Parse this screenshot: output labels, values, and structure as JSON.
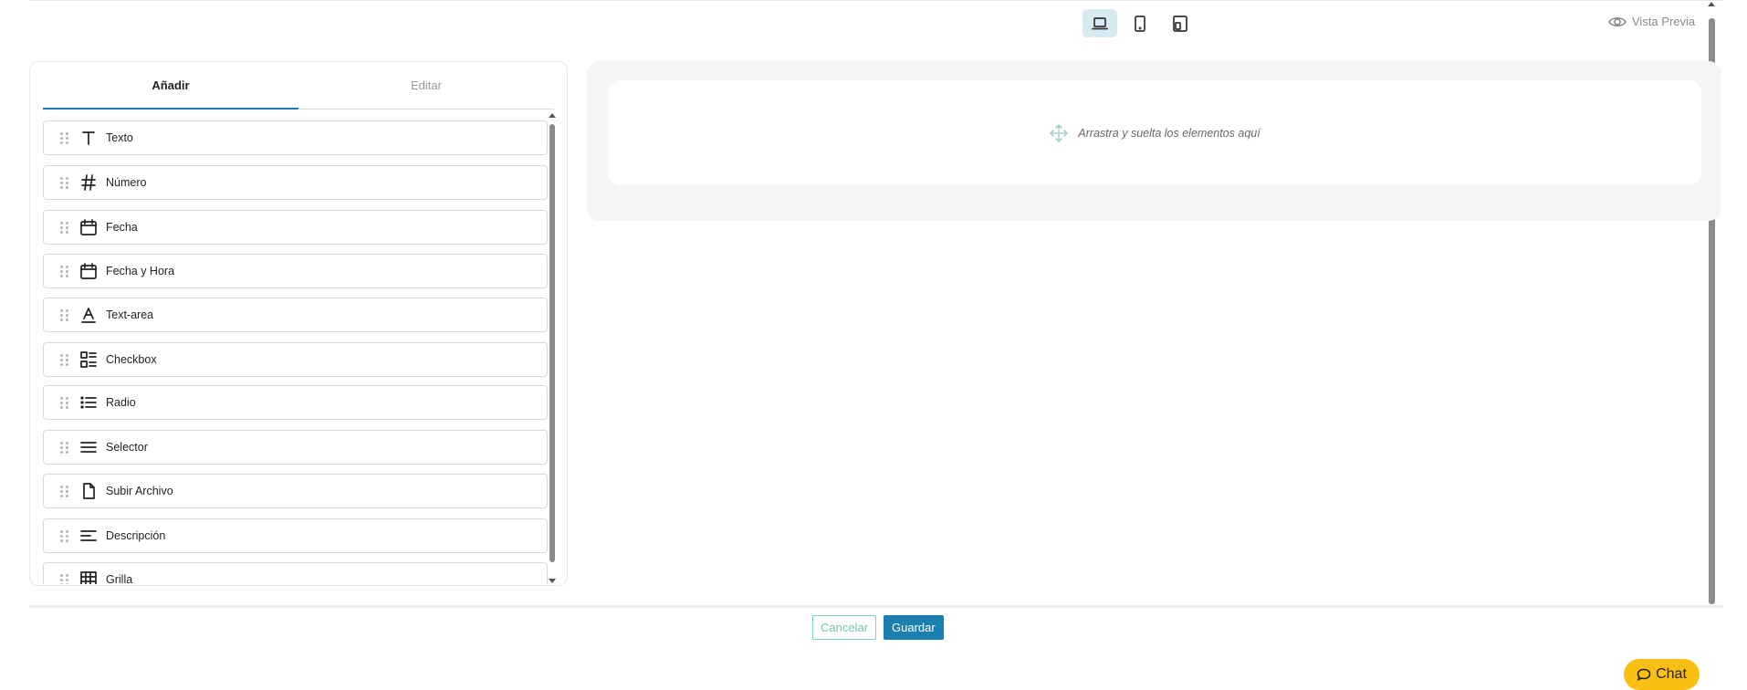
{
  "toolbar": {
    "devices": [
      {
        "name": "laptop-icon",
        "active": true
      },
      {
        "name": "tablet-icon",
        "active": false
      },
      {
        "name": "responsive-icon",
        "active": false
      }
    ],
    "preview_label": "Vista Previa"
  },
  "panel": {
    "tabs": [
      {
        "label": "Añadir",
        "active": true
      },
      {
        "label": "Editar",
        "active": false
      }
    ],
    "items": [
      {
        "label": "Texto",
        "icon": "text-icon"
      },
      {
        "label": "Número",
        "icon": "hash-icon"
      },
      {
        "label": "Fecha",
        "icon": "calendar-icon"
      },
      {
        "label": "Fecha y Hora",
        "icon": "calendar-icon"
      },
      {
        "label": "Text-area",
        "icon": "text-area-icon"
      },
      {
        "label": "Checkbox",
        "icon": "checkbox-list-icon"
      },
      {
        "label": "Radio",
        "icon": "bullet-list-icon"
      },
      {
        "label": "Selector",
        "icon": "menu-lines-icon"
      },
      {
        "label": "Subir Archivo",
        "icon": "file-icon"
      },
      {
        "label": "Descripción",
        "icon": "align-left-icon"
      },
      {
        "label": "Grilla",
        "icon": "grid-icon"
      }
    ]
  },
  "canvas": {
    "placeholder": "Arrastra y suelta los elementos aquí",
    "icon": "move-icon"
  },
  "actions": {
    "cancel_label": "Cancelar",
    "save_label": "Guardar"
  },
  "chat": {
    "label": "Chat",
    "icon": "chat-bubble-icon"
  },
  "colors": {
    "accent": "#1b7fb0",
    "cancel": "#6fc5b6",
    "chat": "#f9c013",
    "active_device": "#d7eaf2"
  }
}
